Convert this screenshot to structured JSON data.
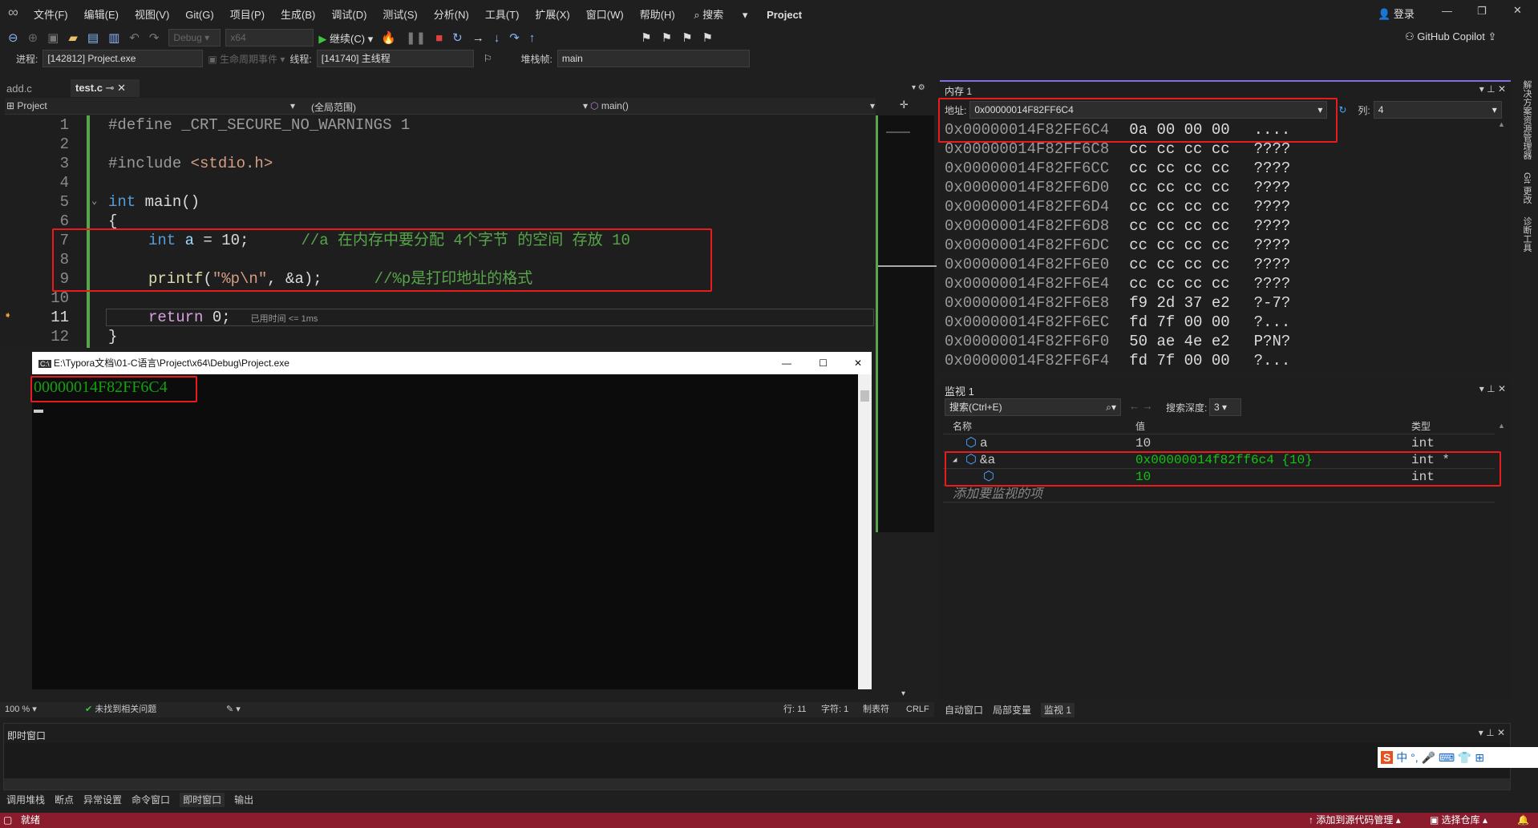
{
  "menubar": {
    "items": [
      "文件(F)",
      "编辑(E)",
      "视图(V)",
      "Git(G)",
      "项目(P)",
      "生成(B)",
      "调试(D)",
      "测试(S)",
      "分析(N)",
      "工具(T)",
      "扩展(X)",
      "窗口(W)",
      "帮助(H)"
    ],
    "search": "搜索",
    "project": "Project",
    "login": "登录"
  },
  "toolbar": {
    "config": "Debug",
    "platform": "x64",
    "continue": "继续(C)",
    "copilot": "GitHub Copilot"
  },
  "debugbar": {
    "process_label": "进程:",
    "process": "[142812] Project.exe",
    "lifecycle": "生命周期事件",
    "thread_label": "线程:",
    "thread": "[141740] 主线程",
    "stack_label": "堆栈帧:",
    "stack": "main"
  },
  "tabs": [
    {
      "label": "add.c"
    },
    {
      "label": "test.c"
    }
  ],
  "navbar": {
    "project": "Project",
    "scope": "(全局范围)",
    "func": "main()"
  },
  "code": {
    "lines": [
      "1",
      "2",
      "3",
      "4",
      "5",
      "6",
      "7",
      "8",
      "9",
      "10",
      "11",
      "12"
    ],
    "l1a": "#define",
    "l1b": " _CRT_SECURE_NO_WARNINGS 1",
    "l3a": "#include",
    "l3b": " <stdio.h>",
    "l5a": "int",
    "l5b": " main()",
    "l6": "{",
    "l7a": "int",
    "l7b": " a",
    "l7c": " = 10;",
    "l7d": "//a 在内存中要分配 4个字节 的空间 存放 10",
    "l9a": "printf",
    "l9b": "(",
    "l9c": "\"%p\\n\"",
    "l9d": ", &a);",
    "l9e": "//%p是打印地址的格式",
    "l11a": "return",
    "l11b": " 0;",
    "l11hint": "已用时间 <= 1ms",
    "l12": "}"
  },
  "console": {
    "title": "E:\\Typora文档\\01-C语言\\Project\\x64\\Debug\\Project.exe",
    "output": "00000014F82FF6C4"
  },
  "memory": {
    "title": "内存 1",
    "address_label": "地址:",
    "address": "0x00000014F82FF6C4",
    "cols_label": "列:",
    "cols": "4",
    "rows": [
      {
        "addr": "0x00000014F82FF6C4",
        "bytes": "0a 00 00 00",
        "ascii": "...."
      },
      {
        "addr": "0x00000014F82FF6C8",
        "bytes": "cc cc cc cc",
        "ascii": "????"
      },
      {
        "addr": "0x00000014F82FF6CC",
        "bytes": "cc cc cc cc",
        "ascii": "????"
      },
      {
        "addr": "0x00000014F82FF6D0",
        "bytes": "cc cc cc cc",
        "ascii": "????"
      },
      {
        "addr": "0x00000014F82FF6D4",
        "bytes": "cc cc cc cc",
        "ascii": "????"
      },
      {
        "addr": "0x00000014F82FF6D8",
        "bytes": "cc cc cc cc",
        "ascii": "????"
      },
      {
        "addr": "0x00000014F82FF6DC",
        "bytes": "cc cc cc cc",
        "ascii": "????"
      },
      {
        "addr": "0x00000014F82FF6E0",
        "bytes": "cc cc cc cc",
        "ascii": "????"
      },
      {
        "addr": "0x00000014F82FF6E4",
        "bytes": "cc cc cc cc",
        "ascii": "????"
      },
      {
        "addr": "0x00000014F82FF6E8",
        "bytes": "f9 2d 37 e2",
        "ascii": "?-7?"
      },
      {
        "addr": "0x00000014F82FF6EC",
        "bytes": "fd 7f 00 00",
        "ascii": "?..."
      },
      {
        "addr": "0x00000014F82FF6F0",
        "bytes": "50 ae 4e e2",
        "ascii": "P?N?"
      },
      {
        "addr": "0x00000014F82FF6F4",
        "bytes": "fd 7f 00 00",
        "ascii": "?..."
      }
    ]
  },
  "watch": {
    "title": "监视 1",
    "search": "搜索(Ctrl+E)",
    "depth_label": "搜索深度:",
    "depth": "3",
    "headers": [
      "名称",
      "值",
      "类型"
    ],
    "rows": [
      {
        "name": "a",
        "value": "10",
        "type": "int"
      },
      {
        "name": "&a",
        "value": "0x00000014f82ff6c4 {10}",
        "type": "int *"
      },
      {
        "name": "",
        "value": "10",
        "type": "int"
      }
    ],
    "add": "添加要监视的项"
  },
  "right_tabs": [
    "自动窗口",
    "局部变量",
    "监视 1"
  ],
  "editor_status": {
    "zoom": "100 %",
    "issues": "未找到相关问题",
    "line": "行: 11",
    "char": "字符: 1",
    "tabs": "制表符",
    "eol": "CRLF"
  },
  "immediate": {
    "title": "即时窗口"
  },
  "bottom_tabs": [
    "调用堆栈",
    "断点",
    "异常设置",
    "命令窗口",
    "即时窗口",
    "输出"
  ],
  "statusbar": {
    "ready": "就绪",
    "source_control": "添加到源代码管理",
    "repo": "选择仓库"
  },
  "side_strip": [
    "解决方案资源管理器",
    "Git 更改",
    "诊断工具"
  ],
  "colors": {
    "accent": "#8a1c2e",
    "highlight": "#e81c1c",
    "console_text": "#13a10e"
  }
}
